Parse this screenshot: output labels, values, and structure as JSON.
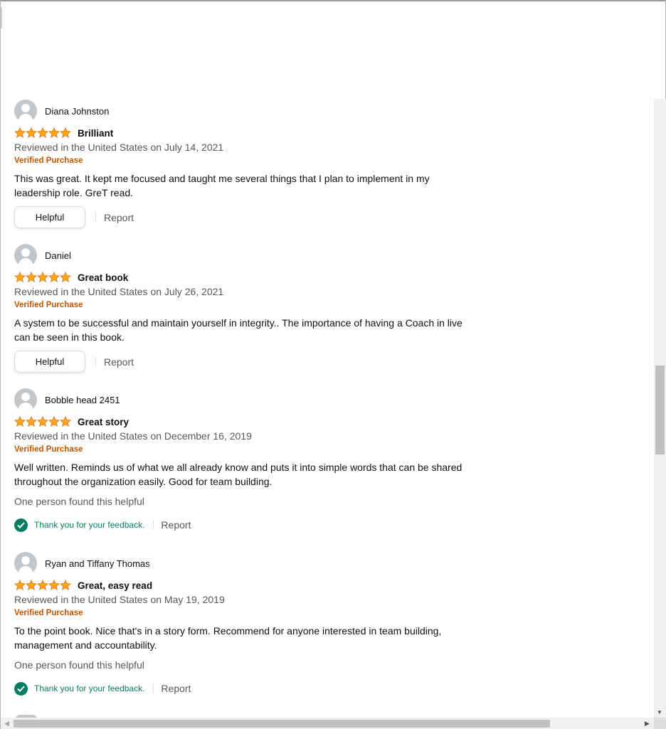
{
  "reviews": [
    {
      "name": "Diana Johnston",
      "stars": 5,
      "title": "Brilliant",
      "date": "Reviewed in the United States on July 14, 2021",
      "verified": "Verified Purchase",
      "text_lines": [
        "This was great. It kept me focused and taught me several things that I plan to implement in my",
        "leadership role. GreT read."
      ],
      "helpful_label": "Helpful",
      "report_label": "Report"
    },
    {
      "name": "Daniel",
      "stars": 5,
      "title": "Great book",
      "date": "Reviewed in the United States on July 26, 2021",
      "verified": "Verified Purchase",
      "text_lines": [
        "A system to be successful and maintain yourself in integrity.. The importance of having a Coach in live",
        "can be seen in this book."
      ],
      "helpful_label": "Helpful",
      "report_label": "Report"
    },
    {
      "name": "Bobble head 2451",
      "stars": 5,
      "title": "Great story",
      "date": "Reviewed in the United States on December 16, 2019",
      "verified": "Verified Purchase",
      "text_lines": [
        "Well written. Reminds us of what we all already know and puts it into simple words that can be shared",
        "throughout the organization easily. Good for team building."
      ],
      "helpful_count": "One person found this helpful",
      "feedback": "Thank you for your feedback.",
      "report_label": "Report"
    },
    {
      "name": "Ryan and Tiffany Thomas",
      "stars": 5,
      "title": "Great, easy read",
      "date": "Reviewed in the United States on May 19, 2019",
      "verified": "Verified Purchase",
      "text_lines": [
        "To the point book. Nice that's in a story form. Recommend for anyone interested in team building,",
        "management and accountability."
      ],
      "helpful_count": "One person found this helpful",
      "feedback": "Thank you for your feedback.",
      "report_label": "Report"
    }
  ],
  "colors": {
    "star": "#ffa41c",
    "star_stroke": "#de7921",
    "verified": "#c45500",
    "feedback": "#067d62",
    "muted": "#565959"
  },
  "icons": {
    "avatar": "default-profile-avatar-icon",
    "star": "star-icon",
    "check": "check-circle-icon"
  },
  "scrollbars": {
    "vertical_position": 0.48,
    "horizontal_position": 0.0
  }
}
